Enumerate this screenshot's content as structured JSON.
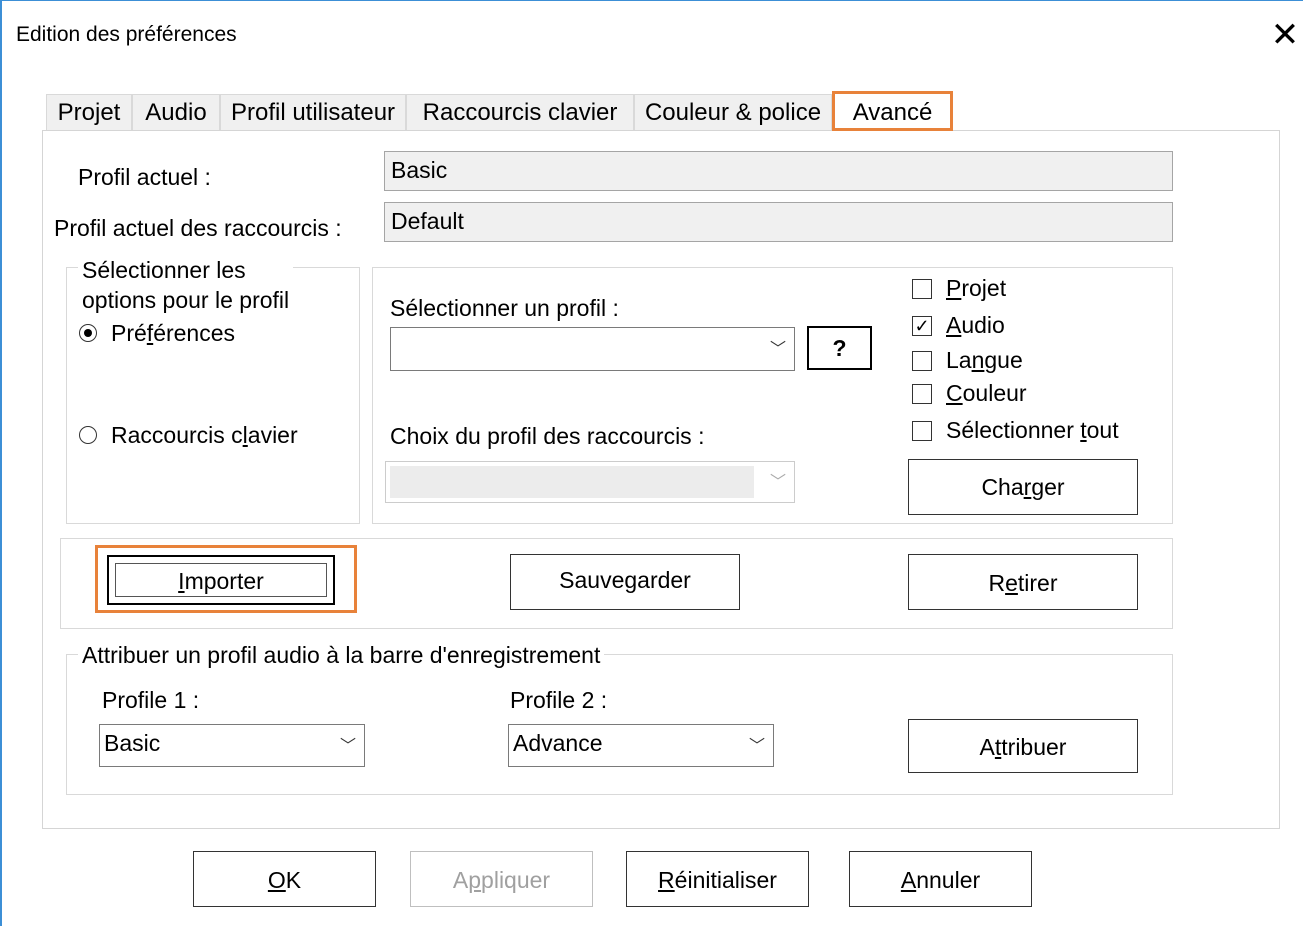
{
  "window": {
    "title": "Edition des préférences",
    "close_glyph": "✕"
  },
  "tabs": [
    {
      "label": "Projet"
    },
    {
      "label": "Audio"
    },
    {
      "label": "Profil utilisateur"
    },
    {
      "label": "Raccourcis clavier"
    },
    {
      "label": "Couleur & police"
    },
    {
      "label": "Avancé",
      "active": true
    }
  ],
  "profile": {
    "current_label": "Profil actuel :",
    "current_value": "Basic",
    "shortcuts_label": "Profil actuel des raccourcis :",
    "shortcuts_value": "Default"
  },
  "options_group": {
    "legend": "Sélectionner les\noptions pour le profil",
    "radio_preferences": {
      "pre": "Pré",
      "u": "f",
      "post": "érences",
      "selected": true
    },
    "radio_shortcuts": {
      "pre": "Raccourcis c",
      "u": "l",
      "post": "avier",
      "selected": false
    }
  },
  "select_profile": {
    "label": "Sélectionner un profil :",
    "value": "",
    "help_button": "?",
    "shortcuts_choice_label": "Choix du profil des raccourcis :",
    "shortcuts_choice_value": ""
  },
  "checkboxes": [
    {
      "pre": "",
      "u": "P",
      "post": "rojet",
      "checked": false
    },
    {
      "pre": "",
      "u": "A",
      "post": "udio",
      "checked": true
    },
    {
      "pre": "La",
      "u": "n",
      "post": "gue",
      "checked": false
    },
    {
      "pre": "",
      "u": "C",
      "post": "ouleur",
      "checked": false
    },
    {
      "pre": "Sélectionner ",
      "u": "t",
      "post": "out",
      "checked": false
    }
  ],
  "check_mark": "✓",
  "charger_button": {
    "pre": "Cha",
    "u": "r",
    "post": "ger"
  },
  "actions": {
    "import": {
      "pre": "",
      "u": "I",
      "post": "mporter"
    },
    "save": {
      "pre": "Sauvegarder",
      "u": "",
      "post": ""
    },
    "remove": {
      "pre": "R",
      "u": "e",
      "post": "tirer"
    }
  },
  "assign_group": {
    "legend": "Attribuer un profil audio à la barre d'enregistrement",
    "profile1_label": "Profile 1 :",
    "profile1_value": "Basic",
    "profile2_label": "Profile 2 :",
    "profile2_value": "Advance",
    "assign_button": {
      "pre": "A",
      "u": "t",
      "post": "tribuer"
    }
  },
  "footer": {
    "ok": {
      "pre": "",
      "u": "O",
      "post": "K"
    },
    "apply": {
      "pre": "A",
      "u": "p",
      "post": "pliquer"
    },
    "reset": {
      "pre": "",
      "u": "R",
      "post": "éinitialiser"
    },
    "cancel": {
      "pre": "",
      "u": "A",
      "post": "nnuler"
    }
  },
  "chevron_glyph": "﹀",
  "colors": {
    "accent_highlight": "#e8823a",
    "window_border": "#3c8fd6",
    "readonly_bg": "#f0f0f0"
  }
}
